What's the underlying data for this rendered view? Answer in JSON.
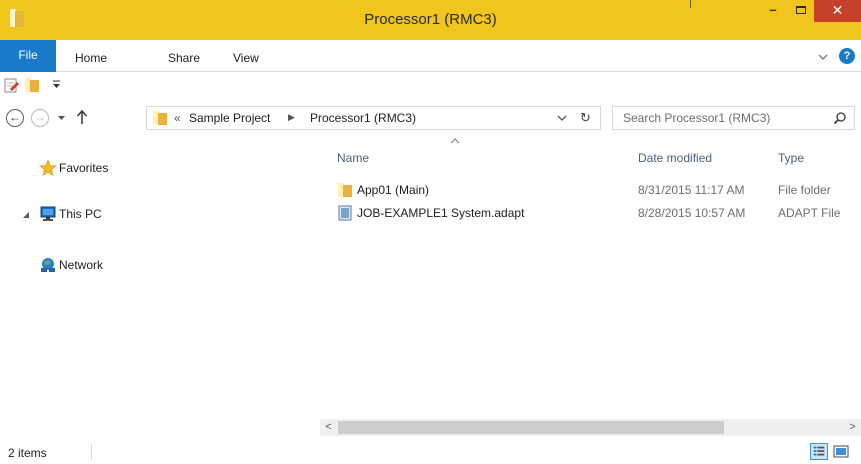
{
  "window": {
    "title": "Processor1 (RMC3)",
    "minimize_glyph": "–",
    "close_glyph": "✕",
    "title_bar_color": "#f0c61c",
    "close_button_color": "#c7402b"
  },
  "ribbon": {
    "tabs": [
      {
        "label": "File"
      },
      {
        "label": "Home"
      },
      {
        "label": "Share"
      },
      {
        "label": "View"
      }
    ],
    "help_glyph": "?",
    "accent_color": "#1979ca"
  },
  "quick_access": {
    "items": [
      "properties-icon",
      "new-folder-icon",
      "customize-dropdown-icon"
    ]
  },
  "navigation": {
    "back_glyph": "←",
    "forward_glyph": "→"
  },
  "address_bar": {
    "overflow_glyph": "«",
    "separator_glyph": "▶",
    "breadcrumbs": [
      {
        "label": "Sample Project"
      },
      {
        "label": "Processor1 (RMC3)"
      }
    ],
    "refresh_glyph": "↻"
  },
  "search": {
    "placeholder": "Search Processor1 (RMC3)"
  },
  "nav_pane": {
    "items": [
      {
        "label": "Favorites",
        "icon": "star-icon"
      },
      {
        "label": "This PC",
        "icon": "computer-icon"
      },
      {
        "label": "Network",
        "icon": "network-icon"
      }
    ]
  },
  "file_list": {
    "columns": [
      {
        "label": "Name"
      },
      {
        "label": "Date modified"
      },
      {
        "label": "Type"
      }
    ],
    "rows": [
      {
        "name": "App01 (Main)",
        "date": "8/31/2015 11:17 AM",
        "type": "File folder",
        "icon": "folder-icon"
      },
      {
        "name": "JOB-EXAMPLE1 System.adapt",
        "date": "8/28/2015 10:57 AM",
        "type": "ADAPT File",
        "icon": "adapt-file-icon"
      }
    ]
  },
  "scrollbar": {
    "left_glyph": "<",
    "right_glyph": ">"
  },
  "status_bar": {
    "item_count": "2 items"
  }
}
